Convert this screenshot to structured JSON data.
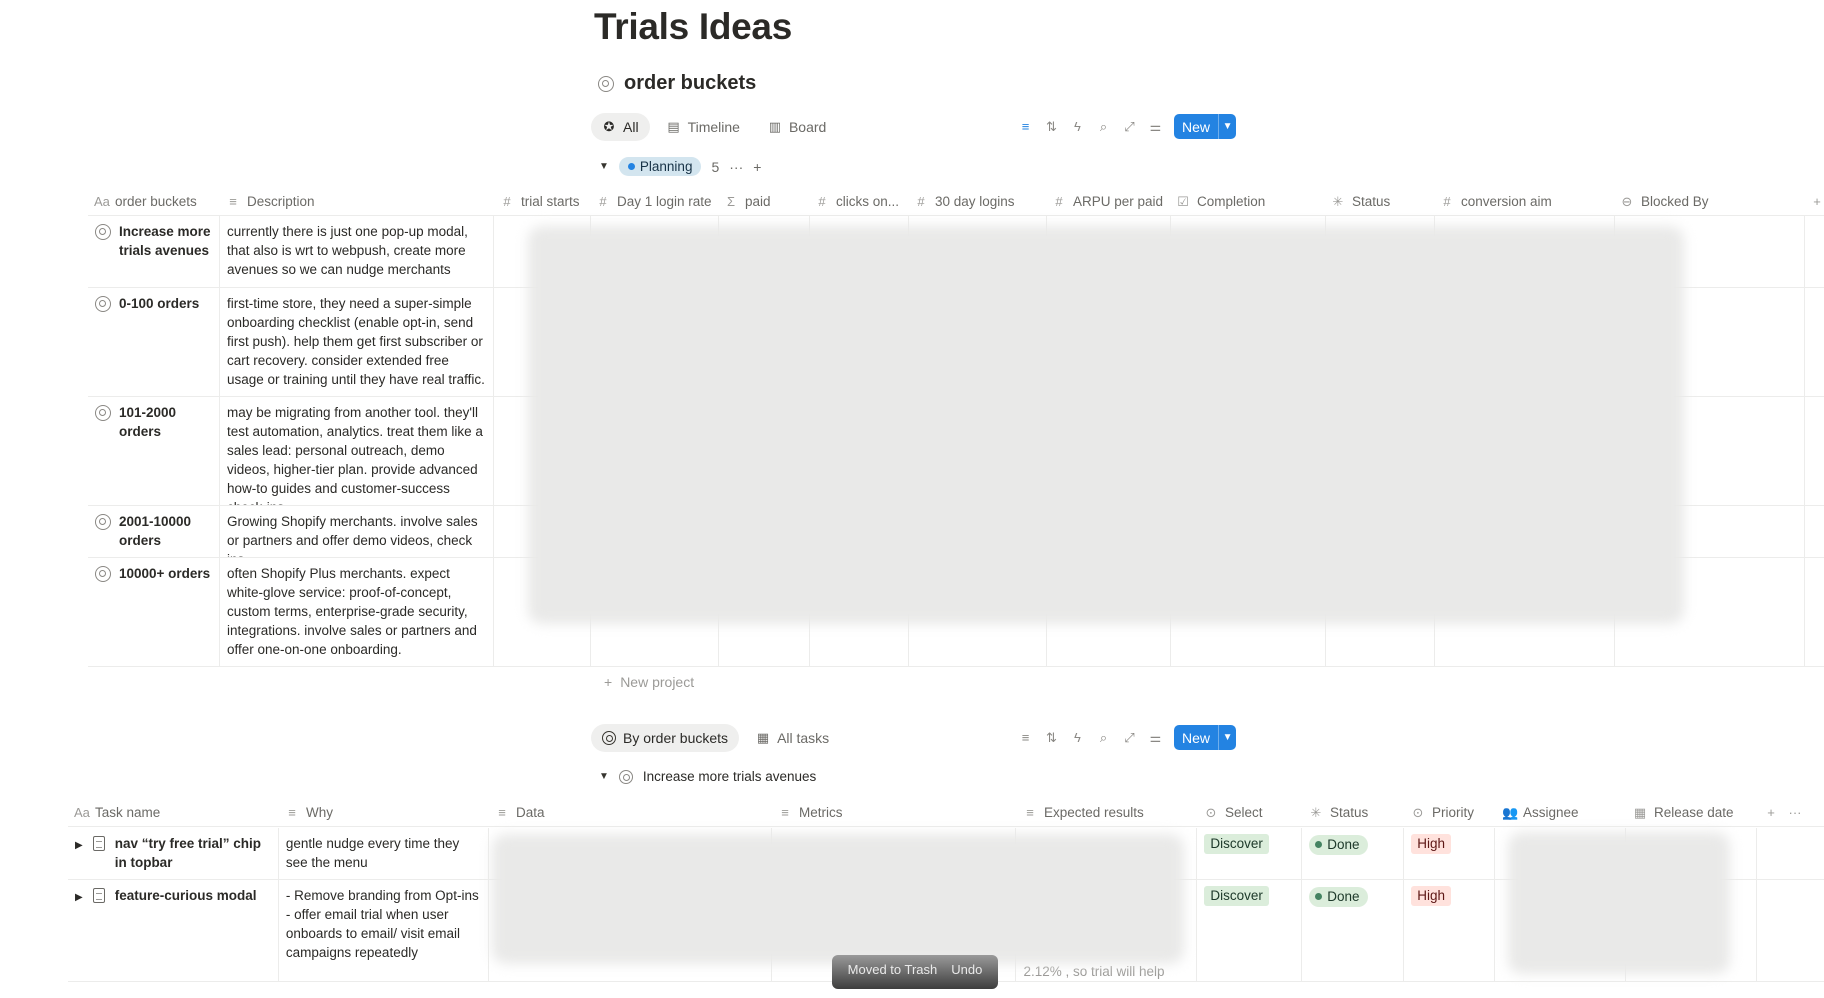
{
  "page": {
    "title": "Trials Ideas"
  },
  "database": {
    "title": "order buckets",
    "views": [
      {
        "label": "All",
        "icon": "star-badge-icon"
      },
      {
        "label": "Timeline",
        "icon": "timeline-icon"
      },
      {
        "label": "Board",
        "icon": "board-icon"
      }
    ],
    "new_label": "New",
    "group": {
      "name": "Planning",
      "count": "5",
      "more": "···",
      "add": "+"
    },
    "columns": [
      "order buckets",
      "Description",
      "trial starts",
      "Day 1 login rate",
      "paid",
      "clicks on...",
      "30 day logins",
      "ARPU per paid",
      "Completion",
      "Status",
      "conversion aim",
      "Blocked By"
    ],
    "column_icons": [
      "Aa",
      "≡",
      "#",
      "#",
      "Σ",
      "#",
      "#",
      "#",
      "☑",
      "✳",
      "#",
      "⊖"
    ],
    "rows": [
      {
        "name": "Increase more trials avenues",
        "description": "currently there is just one pop-up modal, that also is wrt to webpush, create more avenues so we can  nudge merchants"
      },
      {
        "name": "0-100 orders",
        "description": "first-time store, they need a super-simple onboarding checklist (enable opt-in, send first push). help them get first subscriber or cart recovery. consider extended free usage or training until they have real traffic."
      },
      {
        "name": "101-2000 orders",
        "description": "may be migrating from another tool. they'll test automation, analytics. treat them like a sales lead: personal outreach, demo videos, higher-tier plan. provide advanced how-to guides and customer-success check-ins."
      },
      {
        "name": "2001-10000 orders",
        "description": "Growing Shopify merchants. involve sales or partners and offer demo videos, check ins"
      },
      {
        "name": "10000+ orders",
        "description": "often Shopify Plus merchants. expect white-glove service: proof-of-concept, custom terms, enterprise-grade security, integrations. involve sales or partners and offer one-on-one onboarding."
      }
    ],
    "new_project": "New project"
  },
  "tasks": {
    "views": [
      {
        "label": "By order buckets",
        "icon": "target-icon"
      },
      {
        "label": "All tasks",
        "icon": "table-icon"
      }
    ],
    "new_label": "New",
    "group": {
      "name": "Increase more trials avenues"
    },
    "columns": [
      "Task name",
      "Why",
      "Data",
      "Metrics",
      "Expected results",
      "Select",
      "Status",
      "Priority",
      "Assignee",
      "Release date"
    ],
    "column_icons": [
      "Aa",
      "≡",
      "≡",
      "≡",
      "≡",
      "⊙",
      "✳",
      "⊙",
      "👥",
      "▦"
    ],
    "rows": [
      {
        "name": "nav “try free trial” chip in topbar",
        "why": "gentle nudge every time they see the menu",
        "select": "Discover",
        "status": "Done",
        "priority": "High"
      },
      {
        "name": "feature-curious modal",
        "why": "- Remove branding from Opt-ins\n- offer email trial when user onboards to email/ visit email campaigns repeatedly",
        "select": "Discover",
        "status": "Done",
        "priority": "High"
      }
    ],
    "expected_tail": "2.12% , so trial will help"
  },
  "toast": {
    "message": "Moved to Trash",
    "action": "Undo"
  },
  "colors": {
    "accent": "#2383e2",
    "planning_bg": "#d3e5ef",
    "planning_dot": "#2383e2",
    "done_dot": "#448361",
    "discover_bg": "#dbeddb",
    "high_bg": "#ffe2dd"
  }
}
